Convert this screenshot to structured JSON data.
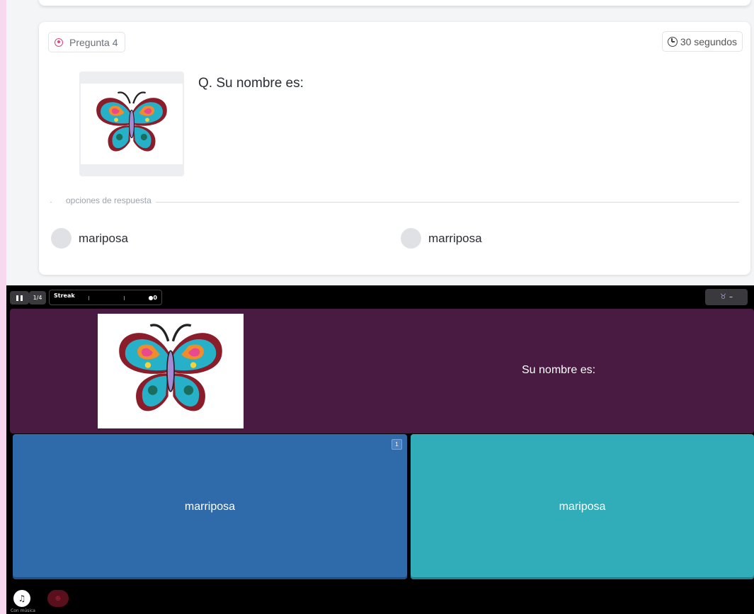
{
  "editor": {
    "question_badge": "Pregunta 4",
    "time_badge": "30 segundos",
    "question_text": "Q. Su nombre es:",
    "options_divider": "opciones de respuesta",
    "options": [
      {
        "label": "mariposa"
      },
      {
        "label": "marriposa"
      }
    ]
  },
  "game": {
    "progress": "1/4",
    "streak_label": "Streak",
    "streak_score": "0",
    "question_text": "Su nombre es:",
    "answers": [
      {
        "label": "marriposa",
        "key": "1",
        "color": "#2f6aab"
      },
      {
        "label": "mariposa",
        "color": "#30adb9"
      }
    ],
    "powerup_value": "–",
    "music_label": "Con música"
  },
  "colors": {
    "accent_pink": "#e0457b",
    "question_panel": "#491a42",
    "left_strip": "#f8d8ef"
  },
  "icons": [
    "target-icon",
    "clock-icon",
    "pause-icon",
    "drop-icon",
    "taurus-icon",
    "music-note-icon",
    "zoom-icon",
    "butterfly-image"
  ]
}
